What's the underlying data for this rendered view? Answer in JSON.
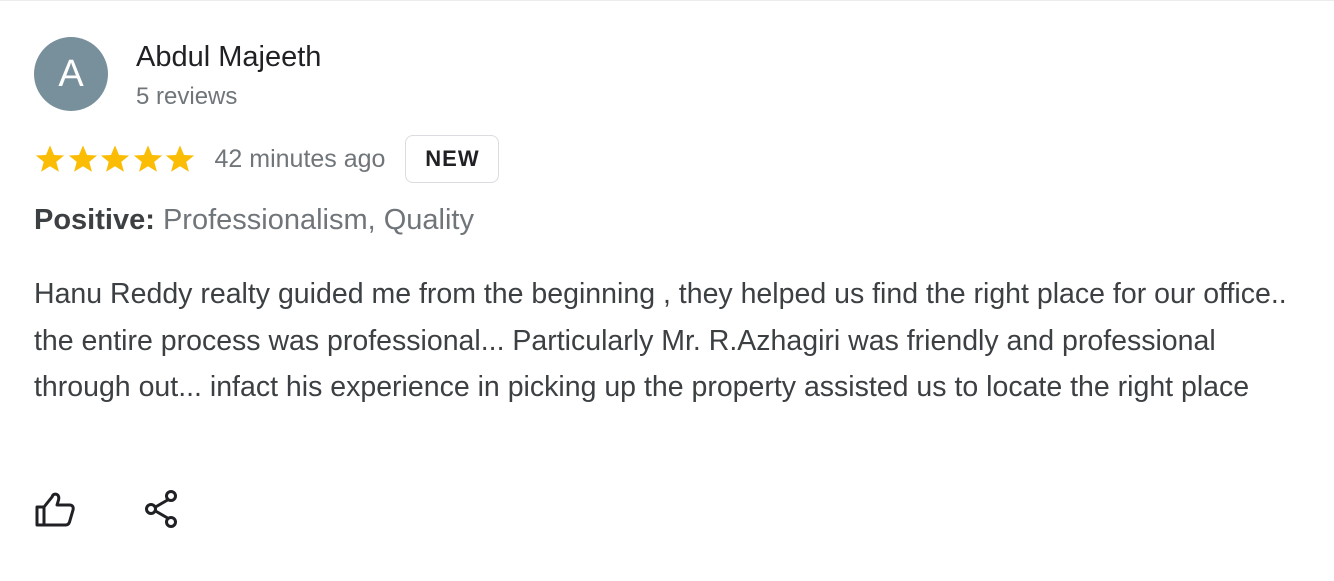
{
  "review": {
    "author": {
      "initial": "A",
      "name": "Abdul Majeeth",
      "review_count": "5 reviews",
      "avatar_color": "#78909c"
    },
    "rating": {
      "stars": 5,
      "max_stars": 5,
      "star_color": "#fbbc04"
    },
    "timestamp": "42 minutes ago",
    "badge": "NEW",
    "highlights": {
      "label": "Positive:",
      "value": "Professionalism, Quality"
    },
    "text": "Hanu Reddy realty guided me from the beginning , they helped us find the right place for our office.. the entire process was professional... Particularly Mr. R.Azhagiri was friendly and professional through out... infact his experience in picking up the property assisted us to locate the right place"
  },
  "actions": {
    "like_icon": "thumbs-up-icon",
    "share_icon": "share-icon"
  }
}
